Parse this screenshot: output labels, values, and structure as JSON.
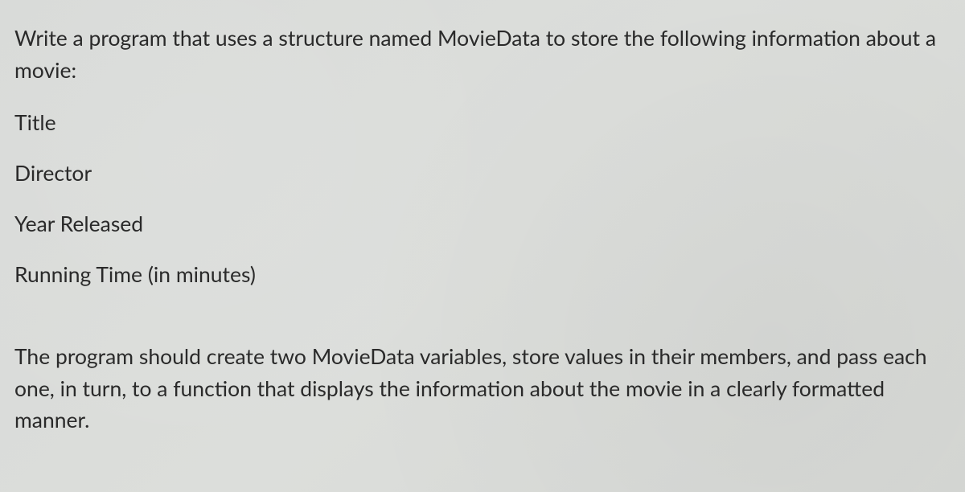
{
  "intro": "Write a program that uses a structure named MovieData to store the following information about a movie:",
  "fields": {
    "title": "Title",
    "director": "Director",
    "year_released": "Year Released",
    "running_time": "Running Time (in minutes)"
  },
  "outro": "The program should create two MovieData variables, store values in their members, and pass each one, in turn, to a function that displays the information about the movie in a clearly formatted manner."
}
